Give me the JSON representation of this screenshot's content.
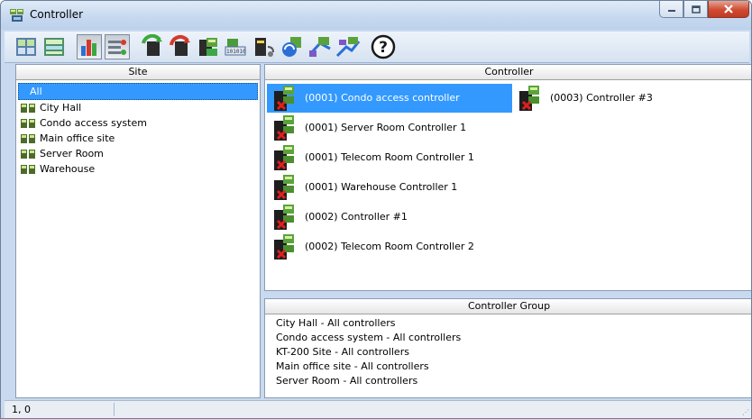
{
  "window": {
    "title": "Controller",
    "buttons": {
      "minimize": "minimize",
      "maximize": "maximize",
      "close": "close"
    }
  },
  "toolbar": {
    "buttons": [
      {
        "icon": "site-view-icon"
      },
      {
        "icon": "site-list-icon"
      },
      {
        "icon": "bar-chart-icon",
        "pressed": true
      },
      {
        "icon": "filter-sliders-icon",
        "pressed": true
      },
      {
        "icon": "refresh-green-icon"
      },
      {
        "icon": "refresh-red-icon"
      },
      {
        "icon": "controller-list-icon"
      },
      {
        "icon": "binary-data-icon"
      },
      {
        "icon": "card-reader-icon"
      },
      {
        "icon": "sync-icon"
      },
      {
        "icon": "network-icon"
      },
      {
        "icon": "multi-network-icon"
      },
      {
        "icon": "help-icon"
      }
    ]
  },
  "site": {
    "header": "Site",
    "items": [
      {
        "label": "All",
        "selected": true
      },
      {
        "label": "City Hall"
      },
      {
        "label": "Condo access system"
      },
      {
        "label": "Main office site"
      },
      {
        "label": "Server Room"
      },
      {
        "label": "Warehouse"
      }
    ]
  },
  "controller": {
    "header": "Controller",
    "items": [
      {
        "label": "(0001) Condo access controller",
        "selected": true
      },
      {
        "label": "(0003) Controller #3"
      },
      {
        "label": "(0001) Server Room Controller 1"
      },
      {
        "label": "(0001) Telecom Room Controller 1"
      },
      {
        "label": "(0001) Warehouse Controller 1"
      },
      {
        "label": "(0002) Controller #1"
      },
      {
        "label": "(0002) Telecom Room Controller 2"
      }
    ]
  },
  "controller_group": {
    "header": "Controller Group",
    "items": [
      "City Hall - All controllers",
      "Condo access system - All controllers",
      "KT-200 Site - All controllers",
      "Main office site - All controllers",
      "Server Room - All controllers"
    ]
  },
  "status": {
    "position": "1, 0"
  },
  "colors": {
    "selection": "#3399ff",
    "chrome": "#c9daf0",
    "close_button": "#cf4c33"
  }
}
